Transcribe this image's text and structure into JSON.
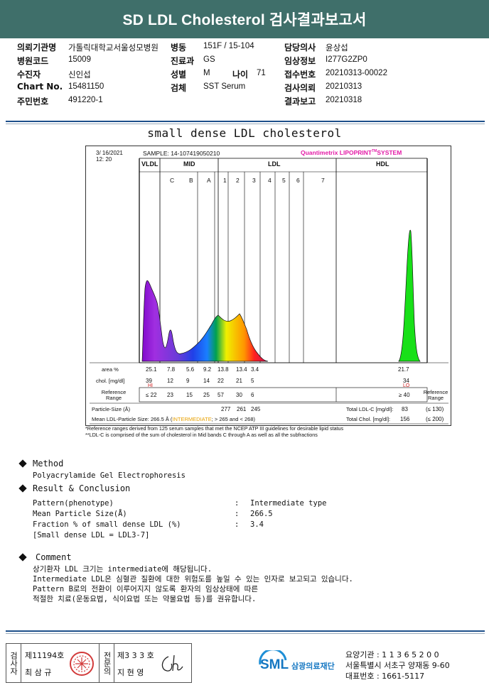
{
  "title": "SD LDL Cholesterol 검사결과보고서",
  "info": {
    "c1": [
      {
        "label": "의뢰기관명",
        "value": "가톨릭대학교서울성모병원"
      },
      {
        "label": "병원코드",
        "value": "15009"
      },
      {
        "label": "수진자",
        "value": "신인섭"
      },
      {
        "label": "Chart No.",
        "value": "15481150"
      },
      {
        "label": "주민번호",
        "value": "491220-1"
      }
    ],
    "c2": [
      {
        "label": "병동",
        "value": "151F / 15-104"
      },
      {
        "label": "진료과",
        "value": "GS"
      },
      {
        "label": "성별",
        "value": "M"
      },
      {
        "label": "검체",
        "value": "SST Serum"
      }
    ],
    "age": {
      "label": "나이",
      "value": "71"
    },
    "c3": [
      {
        "label": "담당의사",
        "value": "윤상섭"
      },
      {
        "label": "임상정보",
        "value": "I277G2ZP0"
      },
      {
        "label": "접수번호",
        "value": "20210313-00022"
      },
      {
        "label": "검사의뢰",
        "value": "20210313"
      },
      {
        "label": "결과보고",
        "value": "20210318"
      }
    ]
  },
  "section_title": "small dense LDL cholesterol",
  "lipoprint": {
    "date": "3/ 16/2021",
    "time": "12: 20",
    "sample": "SAMPLE:  14-107419050210",
    "brand": "Quantimetrix LIPOPRINT",
    "brand_tm": "TM",
    "brand_suffix": "SYSTEM",
    "groups": {
      "vldl": "VLDL",
      "mid": "MID",
      "ldl": "LDL",
      "hdl": "HDL"
    },
    "bands": [
      "C",
      "B",
      "A",
      "1",
      "2",
      "3",
      "4",
      "5",
      "6",
      "7"
    ],
    "area_label": "area %",
    "area": [
      "25.1",
      "7.8",
      "5.6",
      "9.2",
      "13.8",
      "13.4",
      "3.4"
    ],
    "area_hdl": "21.7",
    "chol_label": "chol. [mg/dl]",
    "chol": [
      "39",
      "12",
      "9",
      "14",
      "22",
      "21",
      "5"
    ],
    "chol_hdl": "34",
    "hi": "HI",
    "lo": "LO",
    "ref_label": "Reference Range",
    "ref": [
      "≤ 22",
      "23",
      "15",
      "25",
      "57",
      "30",
      "6"
    ],
    "ref_hdl": "≥ 40",
    "ref_right": "Reference Range",
    "particle_label": "Particle-Size (Å)",
    "particle": [
      "277",
      "261",
      "245"
    ],
    "mean_label": "Mean LDL-Particle Size:",
    "mean_value": "266.5 Å",
    "mean_type": "INTERMEDIATE",
    "mean_rest": "> 265 and < 268)",
    "total_ldl_label": "Total LDL-C [mg/dl]:",
    "total_ldl": "83",
    "total_ldl_ref": "(≤ 130)",
    "total_chol_label": "Total Chol. [mg/dl]:",
    "total_chol": "156",
    "total_chol_ref": "(≤ 200)",
    "note1": "*Reference ranges derived from 125 serum samples that met the NCEP ATP III guidelines for desirable lipid status",
    "note2": "**LDL-C is comprised of the sum of cholesterol in Mid bands C through A as well as all the subfractions"
  },
  "method": {
    "heading": "Method",
    "text": "Polyacrylamide Gel Electrophoresis"
  },
  "result": {
    "heading": "Result & Conclusion",
    "rows": [
      {
        "label": "Pattern(phenotype)",
        "value": "Intermediate type"
      },
      {
        "label": "Mean Particle Size(Å)",
        "value": "266.5"
      },
      {
        "label": "Fraction % of small dense LDL (%)",
        "value": "3.4"
      }
    ],
    "note": "[Small dense LDL = LDL3-7]"
  },
  "comment": {
    "heading": "Comment",
    "lines": [
      "상기환자 LDL 크기는 intermediate에 해당됩니다.",
      "Intermediate LDL은 심혈관 질환에 대한 위험도를 높일 수 있는 인자로 보고되고 있습니다.",
      "Pattern B로의 전환이 이루어지지 않도록 환자의 임상상태에 따른",
      "적절한 치료(운동요법, 식이요법 또는 약물요법 등)를 권유합니다."
    ]
  },
  "footer": {
    "box1": "검사자",
    "id1": "제11194호",
    "name1": "최 삼 규",
    "box2": "전문의",
    "id2": "제3 3 3 호",
    "name2": "지 현 영",
    "logo_text": "SML",
    "org": "삼광의료재단",
    "line1": "요양기관 : 1 1 3 6 5 2 0 0",
    "line2": "서울특별시 서초구 양재동 9-60",
    "line3": "대표번호 : 1661-5117"
  },
  "colors": {
    "header": "#3f6f6a",
    "rule": "#1d4f8a",
    "brand": "#e31aa6",
    "hi": "#d22020",
    "lo": "#d22020",
    "intermediate": "#e8a000"
  }
}
